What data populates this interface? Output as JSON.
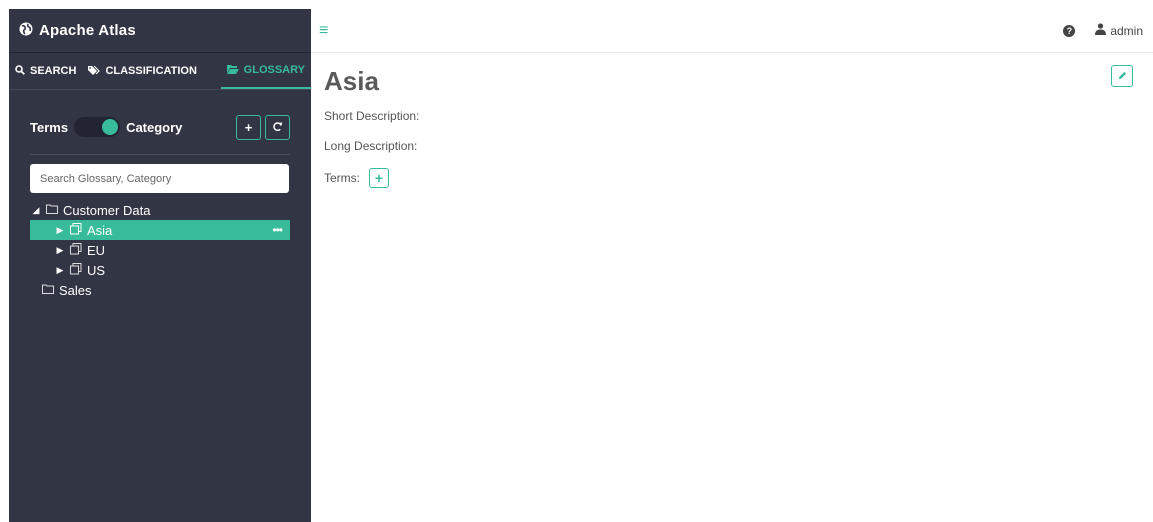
{
  "app": {
    "title": "Apache Atlas"
  },
  "tabs": [
    {
      "label": "SEARCH",
      "icon": "search-icon"
    },
    {
      "label": "CLASSIFICATION",
      "icon": "tag-icon"
    },
    {
      "label": "GLOSSARY",
      "icon": "folder-open-icon",
      "active": true
    }
  ],
  "toggle": {
    "left_label": "Terms",
    "right_label": "Category",
    "state": "Category"
  },
  "search": {
    "placeholder": "Search Glossary, Category"
  },
  "tree": {
    "root": "Customer Data",
    "children": [
      {
        "label": "Asia",
        "selected": true
      },
      {
        "label": "EU"
      },
      {
        "label": "US"
      }
    ],
    "sibling": "Sales"
  },
  "header": {
    "user": "admin"
  },
  "main": {
    "title": "Asia",
    "short_description_label": "Short Description:",
    "long_description_label": "Long Description:",
    "terms_label": "Terms:"
  },
  "colors": {
    "accent": "#37bb9b",
    "sidebar_bg": "#323544"
  }
}
